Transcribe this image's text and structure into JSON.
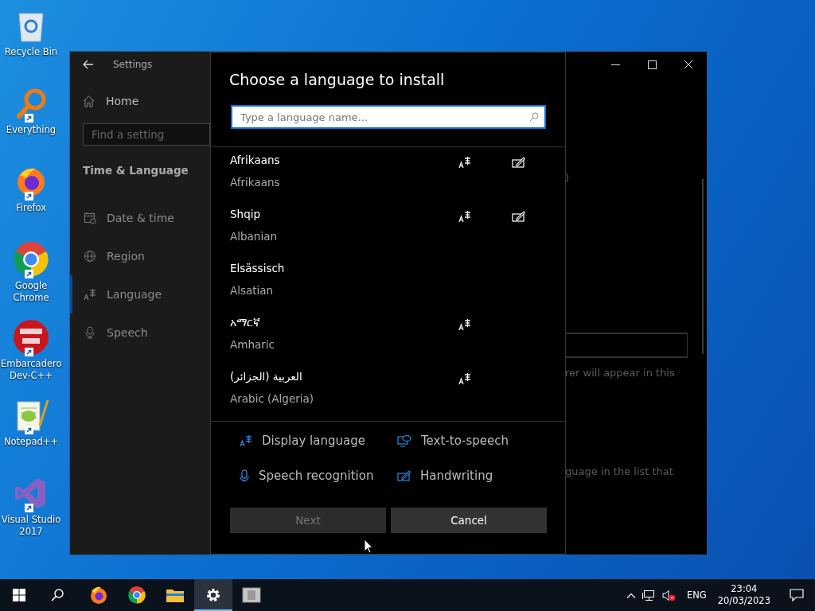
{
  "desktop_icons": [
    {
      "kind": "recycle-bin",
      "label": "Recycle Bin",
      "shortcut": false
    },
    {
      "kind": "magnifier",
      "label": "Everything",
      "shortcut": true
    },
    {
      "kind": "firefox",
      "label": "Firefox",
      "shortcut": true
    },
    {
      "kind": "chrome",
      "label": "Google Chrome",
      "shortcut": true
    },
    {
      "kind": "dev",
      "label": "Embarcadero Dev-C++",
      "shortcut": true
    },
    {
      "kind": "notepad",
      "label": "Notepad++",
      "shortcut": true
    },
    {
      "kind": "vs",
      "label": "Visual Studio 2017",
      "shortcut": true
    }
  ],
  "settings": {
    "title": "Settings",
    "home": "Home",
    "search_placeholder": "Find a setting",
    "section": "Time & Language",
    "items": [
      {
        "kind": "calendar",
        "label": "Date & time",
        "selected": false
      },
      {
        "kind": "globe",
        "label": "Region",
        "selected": false
      },
      {
        "kind": "language",
        "label": "Language",
        "selected": true
      },
      {
        "kind": "mic",
        "label": "Speech",
        "selected": false
      }
    ],
    "background_texts": [
      ")",
      "rer will appear in this",
      "guage in the list that"
    ]
  },
  "dialog": {
    "title": "Choose a language to install",
    "search_placeholder": "Type a language name...",
    "languages": [
      {
        "native": "Afrikaans",
        "english": "Afrikaans",
        "display": true,
        "handwriting": true
      },
      {
        "native": "Shqip",
        "english": "Albanian",
        "display": true,
        "handwriting": true
      },
      {
        "native": "Elsässisch",
        "english": "Alsatian",
        "display": false,
        "handwriting": false
      },
      {
        "native": "አማርኛ",
        "english": "Amharic",
        "display": true,
        "handwriting": false
      },
      {
        "native": "العربية (الجزائر)",
        "english": "Arabic (Algeria)",
        "display": true,
        "handwriting": false
      }
    ],
    "legend": [
      {
        "kind": "display",
        "label": "Display language"
      },
      {
        "kind": "tts",
        "label": "Text-to-speech"
      },
      {
        "kind": "speech",
        "label": "Speech recognition"
      },
      {
        "kind": "handwriting",
        "label": "Handwriting"
      }
    ],
    "buttons": [
      {
        "label": "Next",
        "disabled": true
      },
      {
        "label": "Cancel",
        "disabled": false
      }
    ]
  },
  "taskbar": {
    "apps": [
      {
        "kind": "firefox",
        "active": false
      },
      {
        "kind": "chrome",
        "active": false
      },
      {
        "kind": "folder",
        "active": false
      },
      {
        "kind": "gear",
        "active": true
      },
      {
        "kind": "window",
        "active": false
      }
    ],
    "language": "ENG",
    "time": "23:04",
    "date": "20/03/2023"
  }
}
